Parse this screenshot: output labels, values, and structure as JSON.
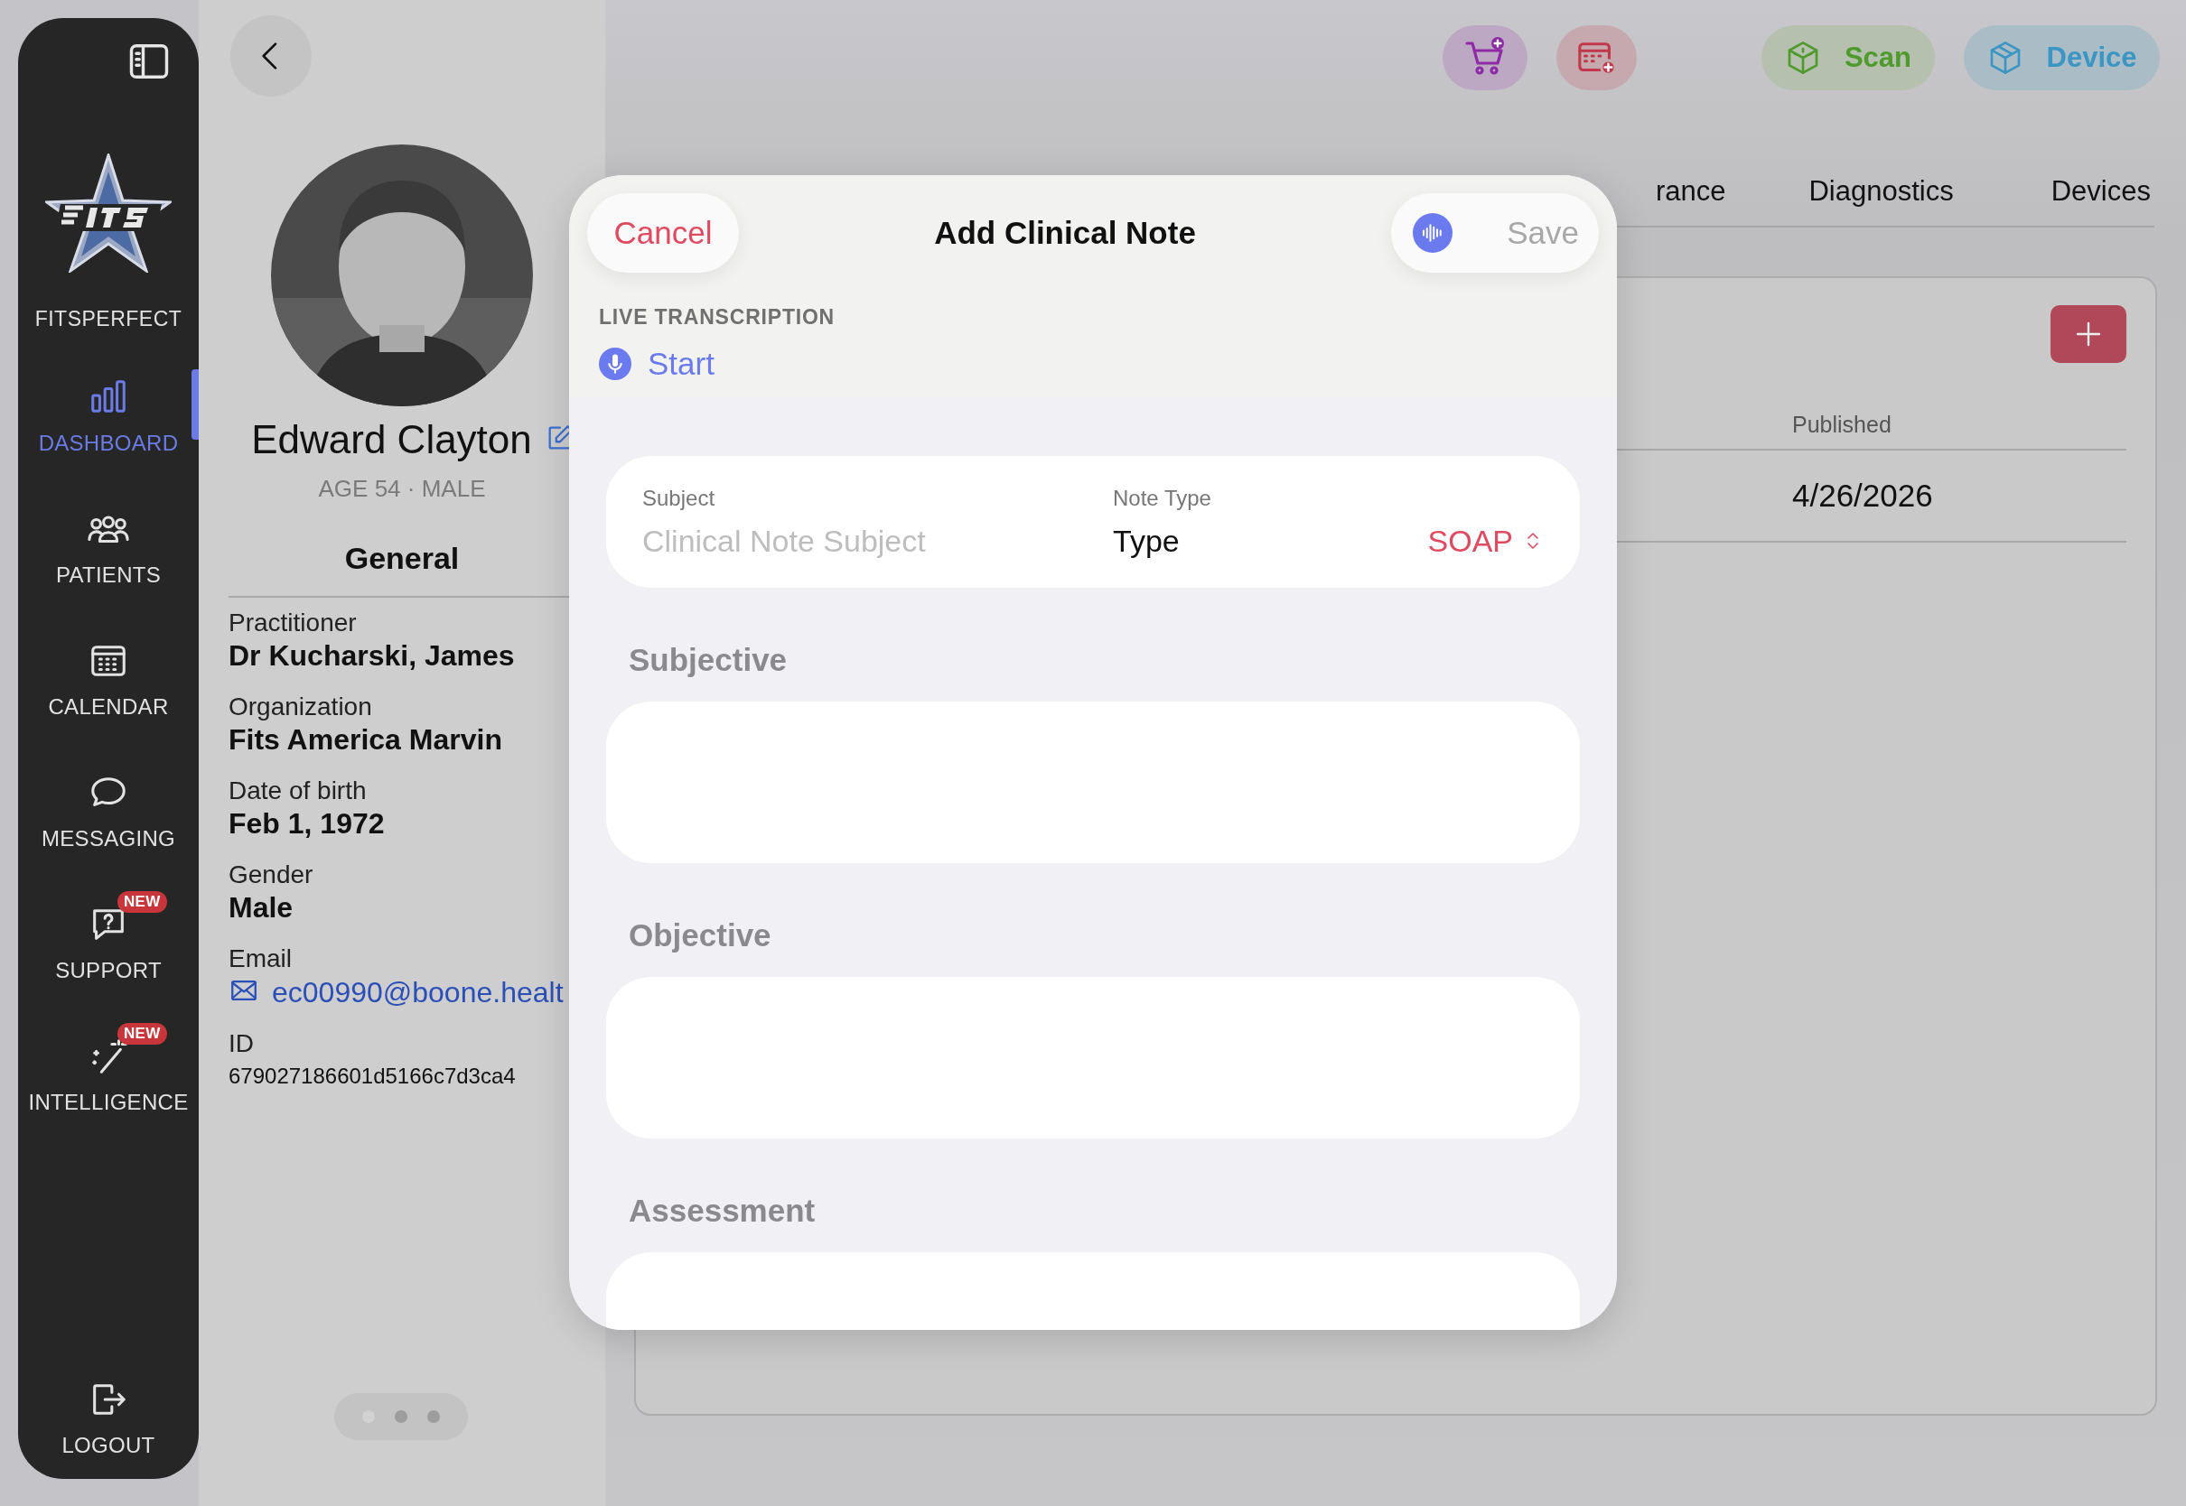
{
  "sidebar": {
    "brand": "FITSPERFECT",
    "items": [
      {
        "label": "DASHBOARD",
        "selected": true
      },
      {
        "label": "PATIENTS",
        "selected": false
      },
      {
        "label": "CALENDAR",
        "selected": false
      },
      {
        "label": "MESSAGING",
        "selected": false
      },
      {
        "label": "SUPPORT",
        "selected": false,
        "badge": "NEW"
      },
      {
        "label": "INTELLIGENCE",
        "selected": false,
        "badge": "NEW"
      }
    ],
    "logout": "LOGOUT"
  },
  "profile": {
    "name": "Edward Clayton",
    "meta": "AGE 54 · MALE",
    "section": "General",
    "fields": [
      {
        "label": "Practitioner",
        "value": "Dr Kucharski, James",
        "kind": "text"
      },
      {
        "label": "Organization",
        "value": "Fits America Marvin",
        "kind": "text"
      },
      {
        "label": "Date of birth",
        "value": "Feb 1, 1972",
        "kind": "text"
      },
      {
        "label": "Gender",
        "value": "Male",
        "kind": "text"
      },
      {
        "label": "Email",
        "value": "ec00990@boone.healt",
        "kind": "email"
      },
      {
        "label": "ID",
        "value": "679027186601d5166c7d3ca4",
        "kind": "id"
      }
    ]
  },
  "toolbar": {
    "scan": "Scan",
    "device": "Device"
  },
  "tabs": [
    {
      "label": "rance"
    },
    {
      "label": "Diagnostics"
    },
    {
      "label": "Devices"
    }
  ],
  "table": {
    "columns": [
      "Published"
    ],
    "rows": [
      [
        "4/26/2026"
      ]
    ]
  },
  "modal": {
    "title": "Add Clinical Note",
    "cancel": "Cancel",
    "save": "Save",
    "save_disabled": true,
    "transcription": {
      "label": "LIVE TRANSCRIPTION",
      "action": "Start"
    },
    "subject": {
      "label": "Subject",
      "placeholder": "Clinical Note Subject"
    },
    "note_type": {
      "label": "Note Type",
      "value": "Type",
      "selection": "SOAP"
    },
    "sections": [
      "Subjective",
      "Objective",
      "Assessment"
    ]
  }
}
